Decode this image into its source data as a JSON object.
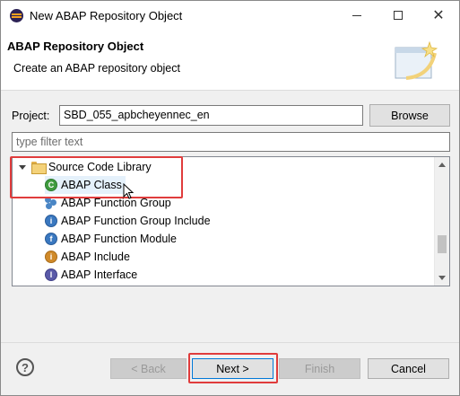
{
  "window": {
    "title": "New ABAP Repository Object",
    "minimize_icon": "minimize-icon",
    "maximize_icon": "maximize-icon",
    "close_icon": "close-icon"
  },
  "header": {
    "title": "ABAP Repository Object",
    "description": "Create an ABAP repository object",
    "icon": "wizard-banner-icon"
  },
  "project": {
    "label": "Project:",
    "value": "SBD_055_apbcheyennec_en",
    "browse_label": "Browse"
  },
  "filter": {
    "placeholder": "type filter text"
  },
  "tree": {
    "folder": {
      "label": "Source Code Library",
      "icon": "folder-open-icon",
      "expanded": true
    },
    "items": [
      {
        "label": "ABAP Class",
        "icon": "abap-class-icon",
        "selected": true
      },
      {
        "label": "ABAP Function Group",
        "icon": "abap-function-group-icon"
      },
      {
        "label": "ABAP Function Group Include",
        "icon": "abap-function-group-include-icon"
      },
      {
        "label": "ABAP Function Module",
        "icon": "abap-function-module-icon"
      },
      {
        "label": "ABAP Include",
        "icon": "abap-include-icon"
      },
      {
        "label": "ABAP Interface",
        "icon": "abap-interface-icon"
      }
    ]
  },
  "footer": {
    "help_icon": "help-icon",
    "back_label": "< Back",
    "next_label": "Next >",
    "finish_label": "Finish",
    "cancel_label": "Cancel"
  },
  "colors": {
    "highlight": "#e03c3c",
    "selection": "#e5f1fb",
    "default_button_border": "#0078d7"
  }
}
